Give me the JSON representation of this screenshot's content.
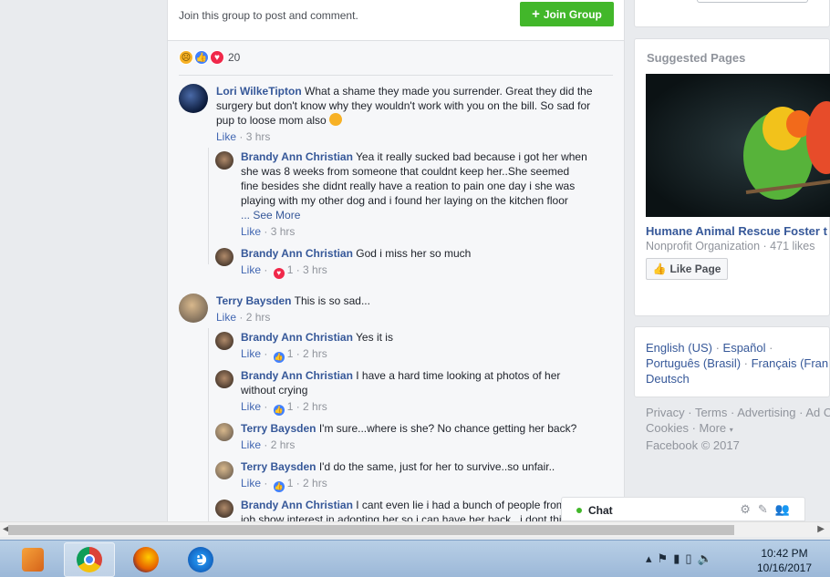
{
  "join_bar": {
    "text": "Join this group to post and comment.",
    "button": "Join Group"
  },
  "reactions": {
    "count": "20"
  },
  "comments": [
    {
      "name": "Lori WilkeTipton",
      "line1": "What a shame they made you surrender. Great they did the",
      "line2": "surgery but don't know why they wouldn't work with you on the bill. So sad for",
      "line3": "pup to loose mom also",
      "like": "Like",
      "time": "3 hrs",
      "replies": [
        {
          "name": "Brandy Ann Christian",
          "line1": "Yea it really sucked bad because i got her when",
          "line2": "she was 8 weeks from someone that couldnt keep her..She seemed",
          "line3": "fine besides she didnt really have a reation to pain one day i she was",
          "line4": "playing with my other dog and i found her laying on the kitchen floor",
          "see_more": "... See More",
          "like": "Like",
          "time": "3 hrs"
        },
        {
          "name": "Brandy Ann Christian",
          "line1": "God i miss her so much",
          "like": "Like",
          "count": "1",
          "time": "3 hrs"
        }
      ]
    },
    {
      "name": "Terry Baysden",
      "line1": "This is so sad...",
      "like": "Like",
      "time": "2 hrs",
      "replies": [
        {
          "name": "Brandy Ann Christian",
          "line1": "Yes it is",
          "like": "Like",
          "count": "1",
          "time": "2 hrs"
        },
        {
          "name": "Brandy Ann Christian",
          "line1": "I have a hard time looking at photos of her",
          "line2": "without crying",
          "like": "Like",
          "count": "1",
          "time": "2 hrs"
        },
        {
          "name": "Terry Baysden",
          "line1": "I'm sure...where is she? No chance getting her back?",
          "like": "Like",
          "time": "2 hrs"
        },
        {
          "name": "Terry Baysden",
          "line1": "I'd do the same, just for her to survive..so unfair..",
          "like": "Like",
          "count": "1",
          "time": "2 hrs"
        },
        {
          "name": "Brandy Ann Christian",
          "line1": "I cant even lie i had a bunch of people from",
          "line2": "job show interest in adopting her so i can have her back...i dont thi"
        }
      ]
    }
  ],
  "sidebar": {
    "suggested_title": "Suggested Pages",
    "page_name": "Humane Animal Rescue Foster t",
    "page_sub": "Nonprofit Organization · 471 likes",
    "like_page": "Like Page",
    "languages": [
      "English (US)",
      "Español",
      "Português (Brasil)",
      "Français (Fran",
      "Deutsch"
    ],
    "footer_line1": [
      "Privacy",
      "Terms",
      "Advertising",
      "Ad C"
    ],
    "footer_line2": [
      "Cookies",
      "More"
    ],
    "copyright": "Facebook © 2017"
  },
  "chat": {
    "label": "Chat"
  },
  "taskbar": {
    "time": "10:42 PM",
    "date": "10/16/2017"
  },
  "icons": [
    "sad-reaction-icon",
    "like-reaction-icon",
    "love-reaction-icon",
    "gear-icon",
    "compose-icon",
    "people-icon",
    "chrome-icon",
    "firefox-icon",
    "internet-explorer-icon",
    "media-player-icon"
  ]
}
